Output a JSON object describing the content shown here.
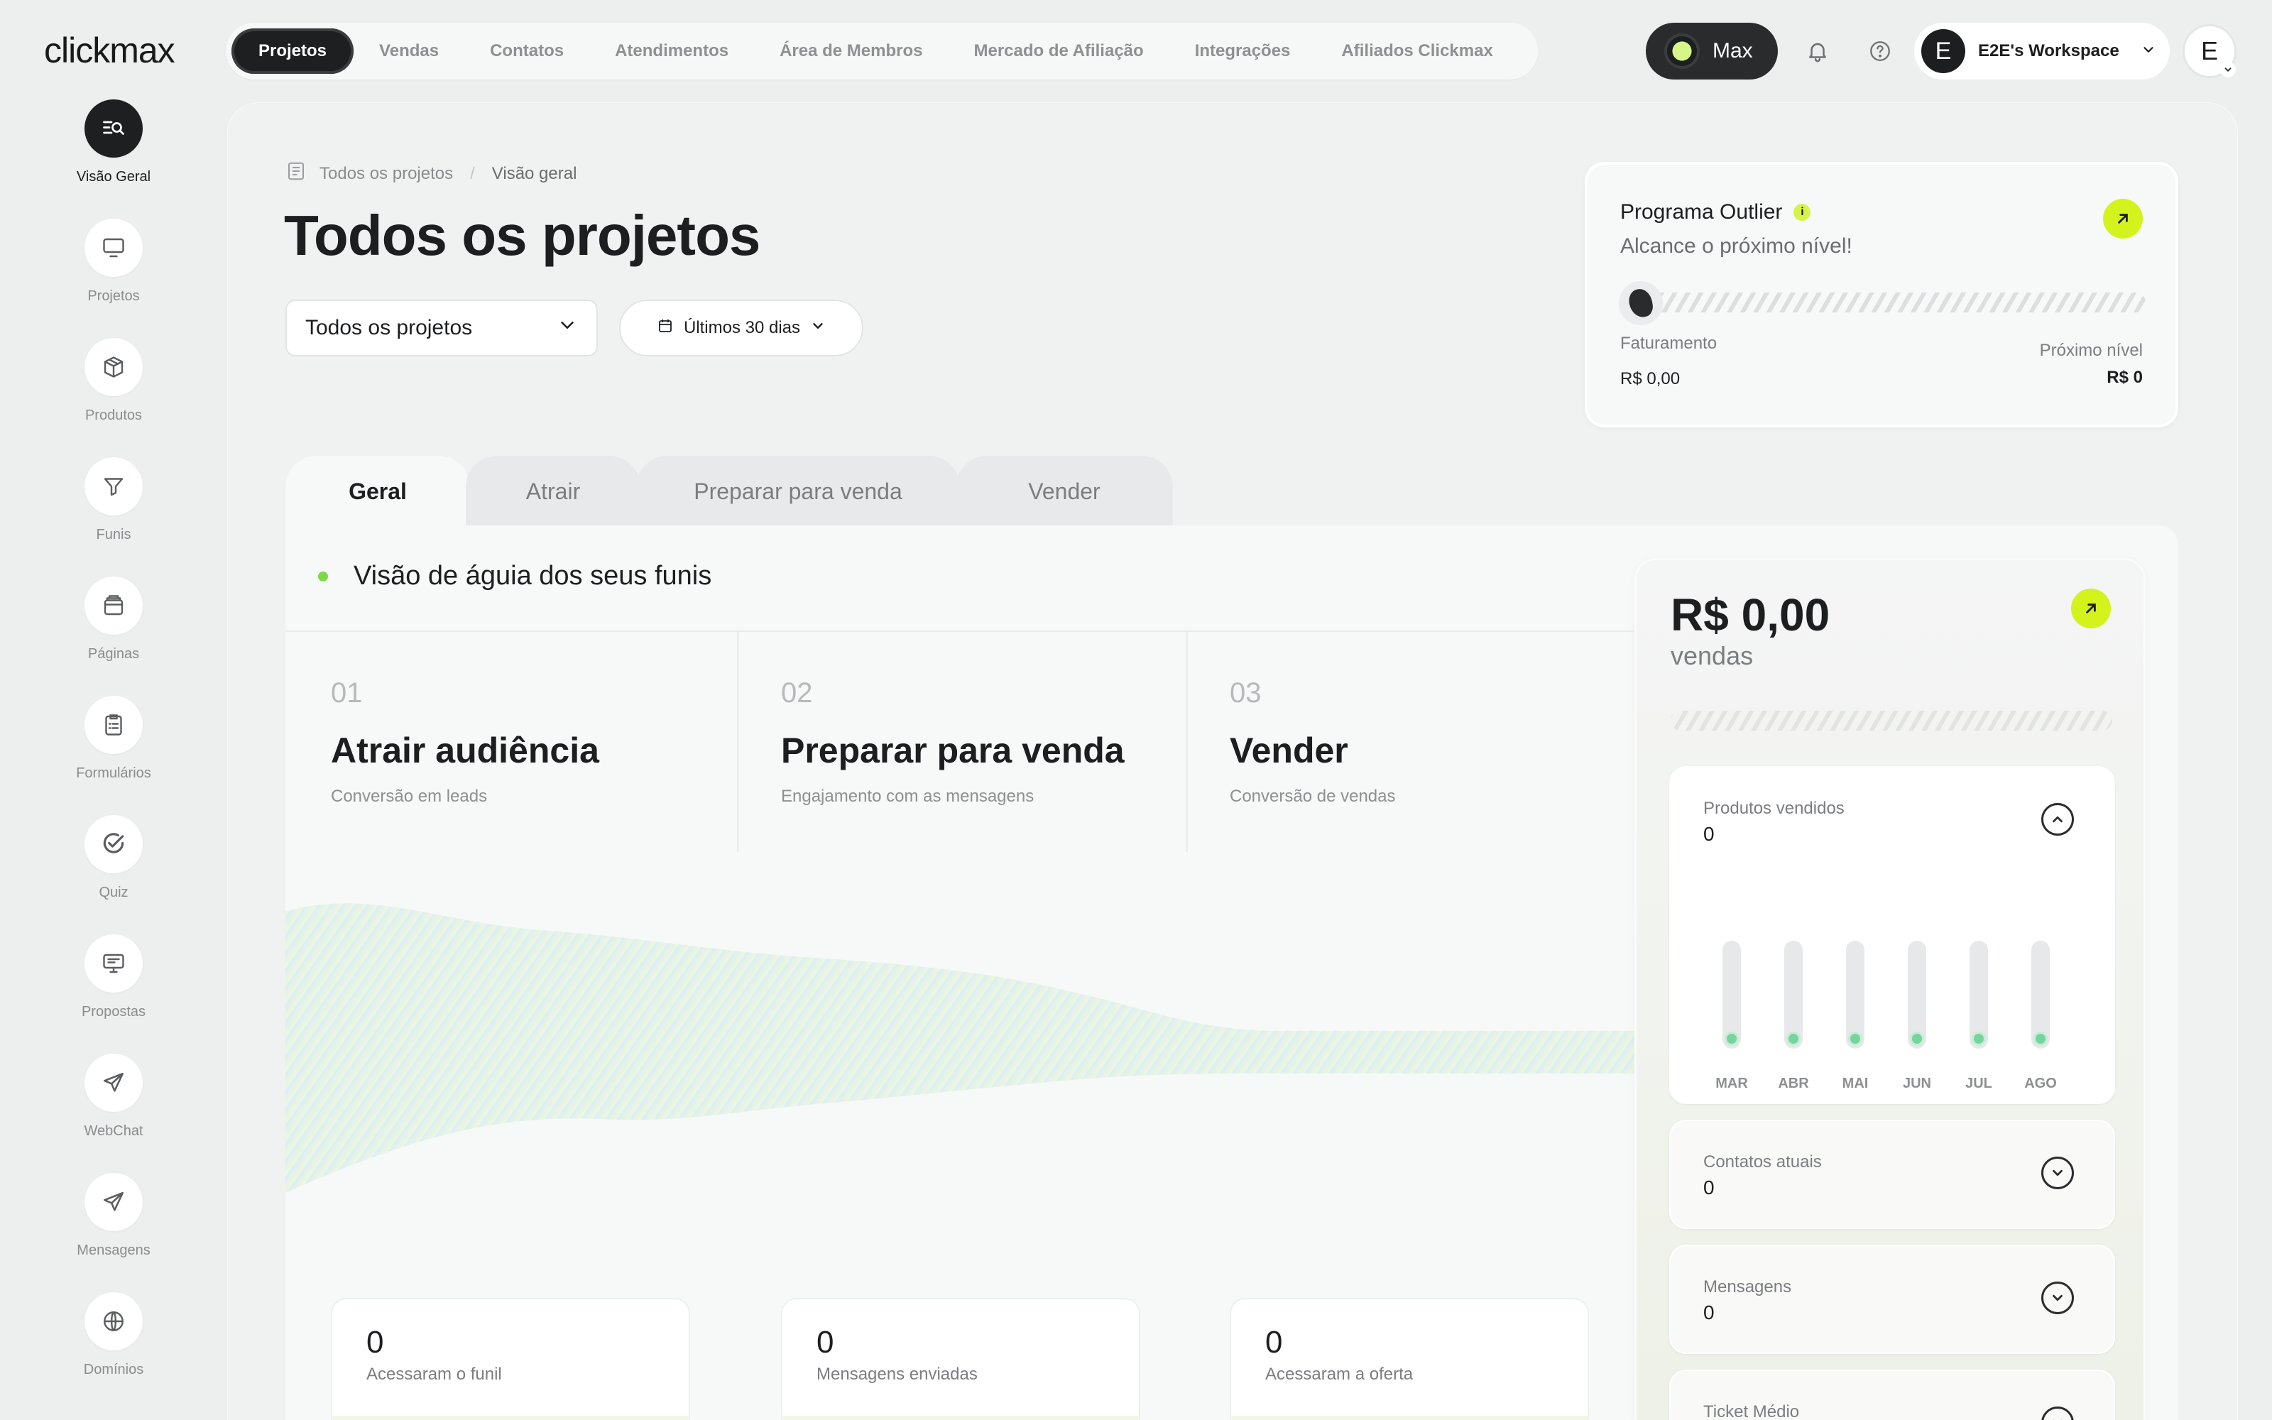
{
  "app": {
    "logo": "clickmax"
  },
  "topnav": {
    "items": [
      {
        "label": "Projetos",
        "active": true
      },
      {
        "label": "Vendas"
      },
      {
        "label": "Contatos"
      },
      {
        "label": "Atendimentos"
      },
      {
        "label": "Área de Membros"
      },
      {
        "label": "Mercado de Afiliação"
      },
      {
        "label": "Integrações"
      },
      {
        "label": "Afiliados Clickmax"
      }
    ],
    "plan_label": "Max",
    "workspace": {
      "avatar_letter": "E",
      "name": "E2E's Workspace"
    },
    "user_avatar_letter": "E"
  },
  "sidebar": {
    "items": [
      {
        "label": "Visão Geral",
        "icon": "overview-icon",
        "active": true
      },
      {
        "label": "Projetos",
        "icon": "monitor-icon"
      },
      {
        "label": "Produtos",
        "icon": "box-icon"
      },
      {
        "label": "Funis",
        "icon": "funnel-icon"
      },
      {
        "label": "Páginas",
        "icon": "pages-icon"
      },
      {
        "label": "Formulários",
        "icon": "clipboard-icon"
      },
      {
        "label": "Quiz",
        "icon": "check-circle-icon"
      },
      {
        "label": "Propostas",
        "icon": "presentation-icon"
      },
      {
        "label": "WebChat",
        "icon": "send-icon"
      },
      {
        "label": "Mensagens",
        "icon": "send-icon"
      },
      {
        "label": "Domínios",
        "icon": "globe-icon"
      }
    ]
  },
  "breadcrumb": {
    "root": "Todos os projetos",
    "separator": "/",
    "current": "Visão geral"
  },
  "page": {
    "title": "Todos os projetos"
  },
  "filters": {
    "project_select": "Todos os projetos",
    "date_range": "Últimos 30 dias"
  },
  "outlier": {
    "title": "Programa Outlier",
    "info": "i",
    "subtitle": "Alcance o próximo nível!",
    "left_label": "Faturamento",
    "left_value": "R$ 0,00",
    "right_label": "Próximo nível",
    "right_value": "R$ 0",
    "progress": 0
  },
  "tabs": [
    {
      "label": "Geral",
      "active": true
    },
    {
      "label": "Atrair"
    },
    {
      "label": "Preparar para venda"
    },
    {
      "label": "Vender"
    }
  ],
  "funnel": {
    "heading": "Visão de águia dos seus funis",
    "stages": [
      {
        "num": "01",
        "title": "Atrair audiência",
        "subtitle": "Conversão em leads"
      },
      {
        "num": "02",
        "title": "Preparar para venda",
        "subtitle": "Engajamento com as mensagens"
      },
      {
        "num": "03",
        "title": "Vender",
        "subtitle": "Conversão de vendas"
      }
    ],
    "metrics": [
      {
        "value": "0",
        "label": "Acessaram o funil"
      },
      {
        "value": "0",
        "label": "Mensagens enviadas"
      },
      {
        "value": "0",
        "label": "Acessaram a oferta"
      }
    ]
  },
  "sales": {
    "amount": "R$ 0,00",
    "label": "vendas",
    "cards": [
      {
        "label": "Produtos vendidos",
        "value": "0",
        "expanded": true
      },
      {
        "label": "Contatos atuais",
        "value": "0"
      },
      {
        "label": "Mensagens",
        "value": "0"
      },
      {
        "label": "Ticket Médio",
        "value": ""
      }
    ],
    "months": [
      "MAR",
      "ABR",
      "MAI",
      "JUN",
      "JUL",
      "AGO"
    ],
    "monthly_values": [
      0,
      0,
      0,
      0,
      0,
      0
    ]
  },
  "colors": {
    "accent": "#d4f31c",
    "dark": "#1e1f21",
    "success": "#76d49c"
  }
}
